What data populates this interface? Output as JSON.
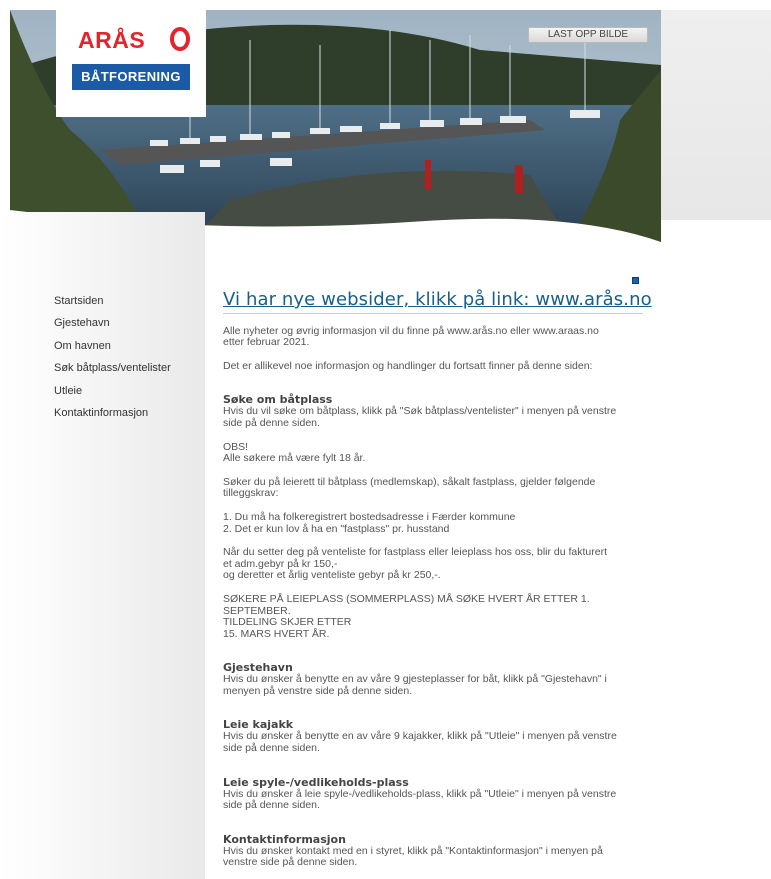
{
  "header": {
    "upload_button": "LAST OPP BILDE",
    "logo_top": "ARÅS",
    "logo_bottom": "BÅTFORENING"
  },
  "nav": {
    "items": [
      "Startsiden",
      "Gjestehavn",
      "Om havnen",
      "Søk båtplass/ventelister",
      "Utleie",
      "Kontaktinformasjon"
    ]
  },
  "content": {
    "headline": "Vi har nye websider, klikk på link: www.arås.no",
    "intro1_l1": "Alle nyheter og øvrig informasjon vil du finne på www.arås.no eller www.araas.no",
    "intro1_l2": "etter februar 2021.",
    "intro2": "Det er allikevel noe informasjon og handlinger du fortsatt finner på denne siden:",
    "s1_title": "Søke om båtplass",
    "s1_l1": "Hvis du vil søke om båtplass, klikk på \"Søk båtplass/ventelister\" i menyen på venstre",
    "s1_l2": "side på denne siden.",
    "obs_l1": "OBS!",
    "obs_l2": "Alle søkere må være fylt 18 år.",
    "fast_l1": "Søker du på leierett til båtplass (medlemskap), såkalt fastplass, gjelder følgende",
    "fast_l2": "tilleggskrav:",
    "req1": "1. Du må ha folkeregistrert bostedsadresse i  Færder kommune",
    "req2": "2. Det er kun lov å ha en \"fastplass\" pr. husstand",
    "fee_l1": "Når du setter deg på venteliste for fastplass eller leieplass hos oss, blir du fakturert",
    "fee_l2": "et adm.gebyr på kr 150,-",
    "fee_l3": "og deretter et årlig venteliste gebyr på kr 250,-.",
    "summer_l1": "SØKERE PÅ LEIEPLASS (SOMMERPLASS) MÅ SØKE HVERT ÅR ETTER 1. SEPTEMBER.",
    "summer_l2": "TILDELING SKJER ETTER",
    "summer_l3": "15. MARS  HVERT ÅR.",
    "s2_title": "Gjestehavn",
    "s2_l1": "Hvis du ønsker å benytte en av våre 9 gjesteplasser for båt, klikk på \"Gjestehavn\" i",
    "s2_l2": "menyen på venstre side på denne siden.",
    "s3_title": "Leie kajakk",
    "s3_l1": "Hvis du ønsker å benytte en av våre 9 kajakker, klikk på \"Utleie\" i menyen på venstre",
    "s3_l2": "side på denne siden.",
    "s4_title": "Leie spyle-/vedlikeholds-plass",
    "s4_l1": "Hvis du ønsker å leie spyle-/vedlikeholds-plass, klikk på \"Utleie\" i menyen på venstre",
    "s4_l2": "side på denne siden.",
    "s5_title": "Kontaktinformasjon",
    "s5_l1": "Hvis du ønsker kontakt med en i styret, klikk på \"Kontaktinformasjon\" i menyen på",
    "s5_l2": "venstre side på denne siden."
  },
  "colors": {
    "headline": "#176089",
    "logo_red": "#e4232c",
    "logo_blue": "#1a5aa6"
  }
}
